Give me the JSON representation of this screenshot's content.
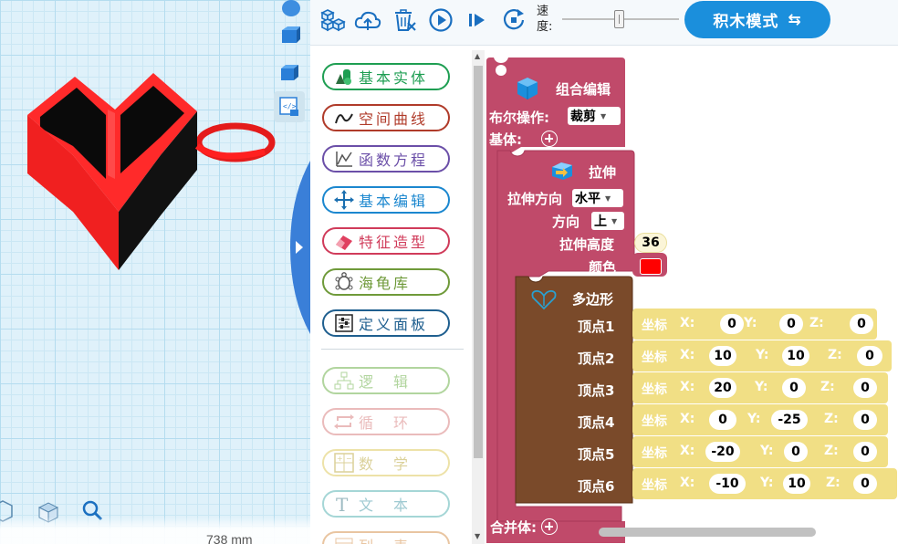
{
  "toolbar": {
    "speed_label": "速度:",
    "speed_value": 0.5,
    "mode_label": "积木模式",
    "mode_icon": "swap-arrows-icon"
  },
  "viewport": {
    "measure_text": "738 mm",
    "model": {
      "shape": "heart keychain",
      "color": "#ff2020"
    }
  },
  "categories": [
    {
      "label": "基本实体",
      "color": "#1e9e52",
      "icon": "solids-icon"
    },
    {
      "label": "空间曲线",
      "color": "#b03b2a",
      "icon": "curve-icon"
    },
    {
      "label": "函数方程",
      "color": "#6b4fa8",
      "icon": "function-icon"
    },
    {
      "label": "基本编辑",
      "color": "#1b87cf",
      "icon": "move-icon"
    },
    {
      "label": "特征造型",
      "color": "#d03b5a",
      "icon": "eraser-icon"
    },
    {
      "label": "海龟库",
      "color": "#6f9a3a",
      "icon": "turtle-icon"
    },
    {
      "label": "定义面板",
      "color": "#1f5f8f",
      "icon": "panel-icon"
    },
    {
      "label": "逻　辑",
      "color": "#54a32a",
      "icon": "logic-icon"
    },
    {
      "label": "循　环",
      "color": "#d26a6a",
      "icon": "loop-icon"
    },
    {
      "label": "数　学",
      "color": "#d8c040",
      "icon": "math-icon"
    },
    {
      "label": "文　本",
      "color": "#3aa5a5",
      "icon": "text-icon"
    },
    {
      "label": "列　表",
      "color": "#d08030",
      "icon": "list-icon"
    }
  ],
  "blocks": {
    "group": {
      "title": "组合编辑",
      "bool_label": "布尔操作:",
      "bool_value": "裁剪",
      "base_label": "基体:",
      "union_label": "合并体:",
      "color": "#c04a6a"
    },
    "extrude": {
      "title": "拉伸",
      "dir_label": "拉伸方向",
      "dir_value": "水平",
      "dir2_label": "方向",
      "dir2_value": "上",
      "height_label": "拉伸高度",
      "height_value": "36",
      "color_label": "颜色",
      "color_value": "#ff0000"
    },
    "polygon": {
      "title": "多边形",
      "color": "#7a4a2a",
      "vertices": [
        {
          "label": "顶点1",
          "coord_label": "坐标",
          "x": "0",
          "y": "0",
          "z": "0"
        },
        {
          "label": "顶点2",
          "coord_label": "坐标",
          "x": "10",
          "y": "10",
          "z": "0"
        },
        {
          "label": "顶点3",
          "coord_label": "坐标",
          "x": "20",
          "y": "0",
          "z": "0"
        },
        {
          "label": "顶点4",
          "coord_label": "坐标",
          "x": "0",
          "y": "-25",
          "z": "0"
        },
        {
          "label": "顶点5",
          "coord_label": "坐标",
          "x": "-20",
          "y": "0",
          "z": "0"
        },
        {
          "label": "顶点6",
          "coord_label": "坐标",
          "x": "-10",
          "y": "10",
          "z": "0"
        }
      ]
    },
    "axis": {
      "x": "X:",
      "y": "Y:",
      "z": "Z:"
    }
  }
}
